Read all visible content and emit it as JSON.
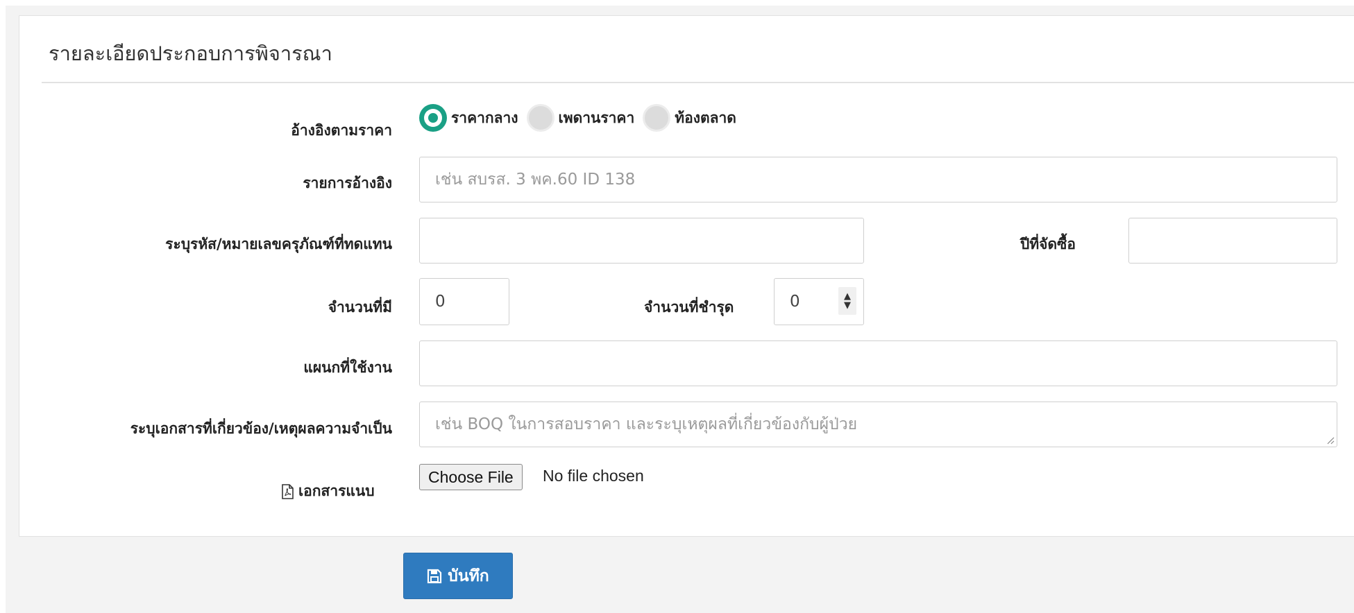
{
  "panel": {
    "title": "รายละเอียดประกอบการพิจารณา"
  },
  "price_reference": {
    "label": "อ้างอิงตามราคา",
    "options": [
      {
        "label": "ราคากลาง",
        "selected": true
      },
      {
        "label": "เพดานราคา",
        "selected": false
      },
      {
        "label": "ท้องตลาด",
        "selected": false
      }
    ]
  },
  "reference_item": {
    "label": "รายการอ้างอิง",
    "placeholder": "เช่น สบรส. 3 พค.60 ID 138",
    "value": ""
  },
  "replacement_code": {
    "label": "ระบุรหัส/หมายเลขครุภัณฑ์ที่ทดแทน",
    "value": ""
  },
  "purchase_year": {
    "label": "ปีที่จัดซื้อ",
    "value": ""
  },
  "quantity": {
    "label": "จำนวนที่มี",
    "value": "0"
  },
  "damaged_quantity": {
    "label": "จำนวนที่ชำรุด",
    "value": "0"
  },
  "department": {
    "label": "แผนกที่ใช้งาน",
    "value": ""
  },
  "documents": {
    "label": "ระบุเอกสารที่เกี่ยวข้อง/เหตุผลความจำเป็น",
    "placeholder": "เช่น BOQ ในการสอบราคา และระบุเหตุผลที่เกี่ยวข้องกับผู้ป่วย",
    "value": ""
  },
  "attachment": {
    "label": "เอกสารแนบ",
    "button": "Choose File",
    "status": "No file chosen",
    "icon": "pdf-file-icon"
  },
  "save": {
    "label": "บันทึก",
    "icon": "floppy-disk-icon"
  },
  "colors": {
    "radio_selected": "#1aa085",
    "save_button": "#2f7bbf"
  }
}
